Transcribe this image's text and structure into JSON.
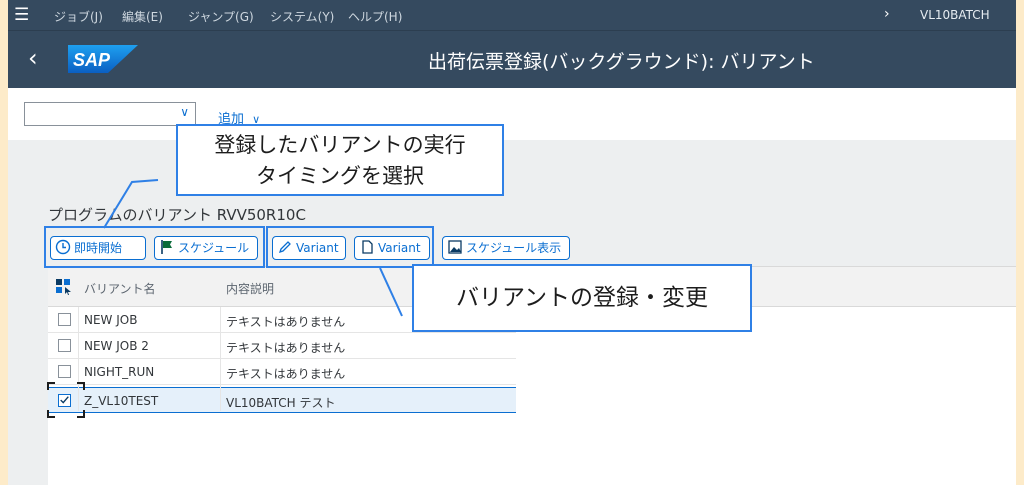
{
  "menu": {
    "items": [
      "ジョブ(J)",
      "編集(E)",
      "ジャンプ(G)",
      "システム(Y)",
      "ヘルプ(H)"
    ],
    "system_id": "VL10BATCH"
  },
  "titlebar": {
    "logo_text": "SAP",
    "title": "出荷伝票登録(バックグラウンド): バリアント"
  },
  "toolbar": {
    "combo_value": "",
    "add_label": "追加"
  },
  "program_title": "プログラムのバリアント RVV50R10C",
  "buttons": {
    "start_now": "即時開始",
    "schedule": "スケジュール",
    "variant_edit": "Variant",
    "variant_create": "Variant",
    "schedule_display": "スケジュール表示"
  },
  "table": {
    "columns": [
      "バリアント名",
      "内容説明"
    ],
    "rows": [
      {
        "name": "NEW JOB",
        "desc": "テキストはありません",
        "checked": false
      },
      {
        "name": "NEW JOB 2",
        "desc": "テキストはありません",
        "checked": false
      },
      {
        "name": "NIGHT_RUN",
        "desc": "テキストはありません",
        "checked": false
      },
      {
        "name": "Z_VL10TEST",
        "desc": "VL10BATCH テスト",
        "checked": true
      }
    ]
  },
  "callouts": {
    "timing_line1": "登録したバリアントの実行",
    "timing_line2": "タイミングを選択",
    "variant_edit": "バリアントの登録・変更"
  },
  "colors": {
    "shell": "#354a5f",
    "accent": "#0a6ed1",
    "callout_border": "#2f80e6",
    "page_bg": "#fdebc9"
  }
}
